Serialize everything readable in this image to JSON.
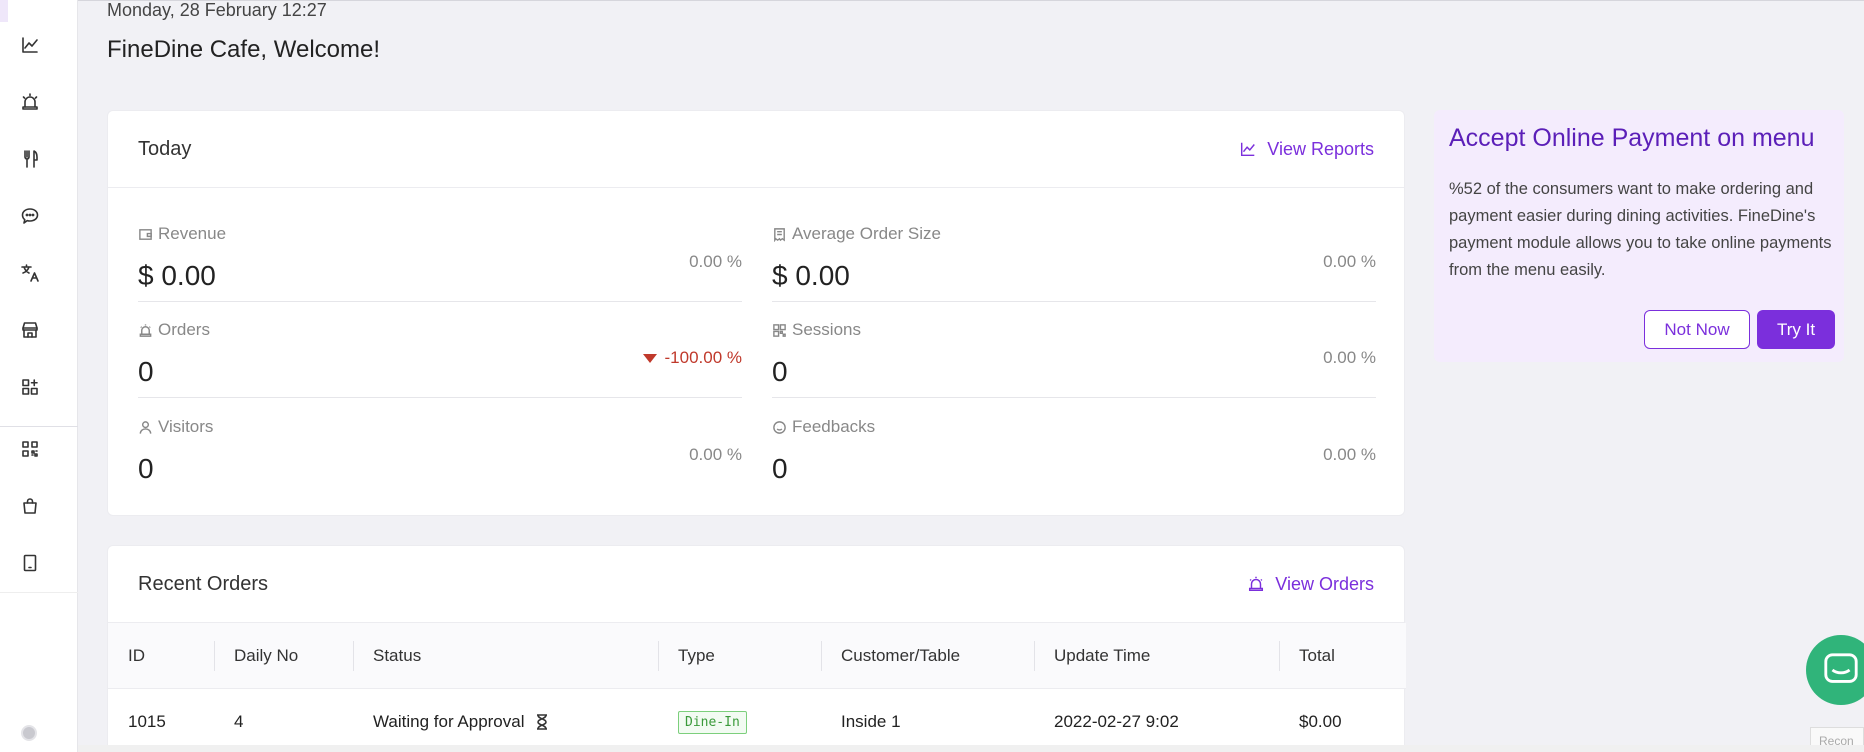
{
  "header": {
    "date": "Monday, 28 February 12:27",
    "welcome": "FineDine Cafe, Welcome!"
  },
  "sidebar": {
    "items": [
      {
        "icon": "chart-line-icon"
      },
      {
        "icon": "alarm-icon"
      },
      {
        "icon": "utensils-icon"
      },
      {
        "icon": "chat-icon"
      },
      {
        "icon": "translate-icon"
      },
      {
        "icon": "store-icon"
      },
      {
        "icon": "apps-add-icon"
      },
      {
        "icon": "qr-code-icon"
      },
      {
        "icon": "shopping-bag-icon"
      },
      {
        "icon": "tablet-icon"
      }
    ]
  },
  "today": {
    "title": "Today",
    "link": "View Reports",
    "stats": [
      {
        "label": "Revenue",
        "value": "$ 0.00",
        "pct": "0.00 %",
        "icon": "wallet-icon"
      },
      {
        "label": "Average Order Size",
        "value": "$ 0.00",
        "pct": "0.00 %",
        "icon": "receipt-icon"
      },
      {
        "label": "Orders",
        "value": "0",
        "pct": "-100.00 %",
        "icon": "alarm-icon",
        "trend": "down"
      },
      {
        "label": "Sessions",
        "value": "0",
        "pct": "0.00 %",
        "icon": "qr-code-icon"
      },
      {
        "label": "Visitors",
        "value": "0",
        "pct": "0.00 %",
        "icon": "user-icon"
      },
      {
        "label": "Feedbacks",
        "value": "0",
        "pct": "0.00 %",
        "icon": "smile-icon"
      }
    ]
  },
  "promo": {
    "title": "Accept Online Payment on menu",
    "text": "%52 of the consumers want to make ordering and payment easier during dining activities. FineDine's payment module allows you to take online payments from the menu easily.",
    "not_now": "Not Now",
    "try_it": "Try It"
  },
  "recent": {
    "title": "Recent Orders",
    "link": "View Orders",
    "columns": [
      "ID",
      "Daily No",
      "Status",
      "Type",
      "Customer/Table",
      "Update Time",
      "Total"
    ],
    "rows": [
      {
        "id": "1015",
        "daily_no": "4",
        "status": "Waiting for Approval",
        "type": "Dine-In",
        "customer": "Inside 1",
        "update_time": "2022-02-27 9:02",
        "total": "$0.00"
      }
    ]
  },
  "recaptcha": "Recon",
  "colors": {
    "accent": "#7b2fdc",
    "negative": "#c0392b",
    "chat": "#30b47a"
  }
}
